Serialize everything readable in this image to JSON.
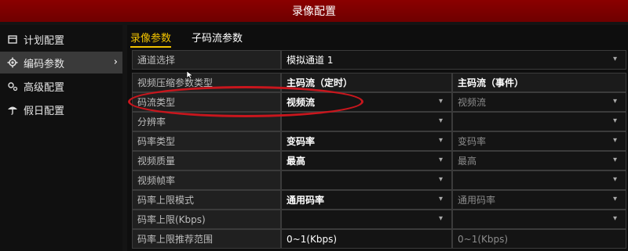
{
  "window": {
    "title": "录像配置"
  },
  "sidebar": {
    "items": [
      {
        "label": "计划配置",
        "icon": "calendar-icon",
        "active": false
      },
      {
        "label": "编码参数",
        "icon": "gear-icon",
        "active": true,
        "chevron": "›"
      },
      {
        "label": "高级配置",
        "icon": "advanced-gear-icon",
        "active": false
      },
      {
        "label": "假日配置",
        "icon": "umbrella-icon",
        "active": false
      }
    ]
  },
  "tabs": [
    {
      "label": "录像参数",
      "active": true
    },
    {
      "label": "子码流参数",
      "active": false
    }
  ],
  "form": {
    "channel": {
      "label": "通道选择",
      "value": "模拟通道 1"
    },
    "header": {
      "label": "视频压缩参数类型",
      "col1": "主码流（定时）",
      "col2": "主码流（事件）"
    },
    "rows": [
      {
        "label": "码流类型",
        "col1": "视频流",
        "col2": "视频流"
      },
      {
        "label": "分辨率",
        "col1": "",
        "col2": ""
      },
      {
        "label": "码率类型",
        "col1": "变码率",
        "col2": "变码率"
      },
      {
        "label": "视频质量",
        "col1": "最高",
        "col2": "最高"
      },
      {
        "label": "视频帧率",
        "col1": "",
        "col2": ""
      },
      {
        "label": "码率上限模式",
        "col1": "通用码率",
        "col2": "通用码率"
      },
      {
        "label": "码率上限(Kbps)",
        "col1": "",
        "col2": ""
      },
      {
        "label": "码率上限推荐范围",
        "col1": "0~1(Kbps)",
        "col2": "0~1(Kbps)"
      }
    ]
  },
  "colors": {
    "title_bar": "#8b0000",
    "tab_active": "#f2c300",
    "annotation": "#c8161d"
  }
}
